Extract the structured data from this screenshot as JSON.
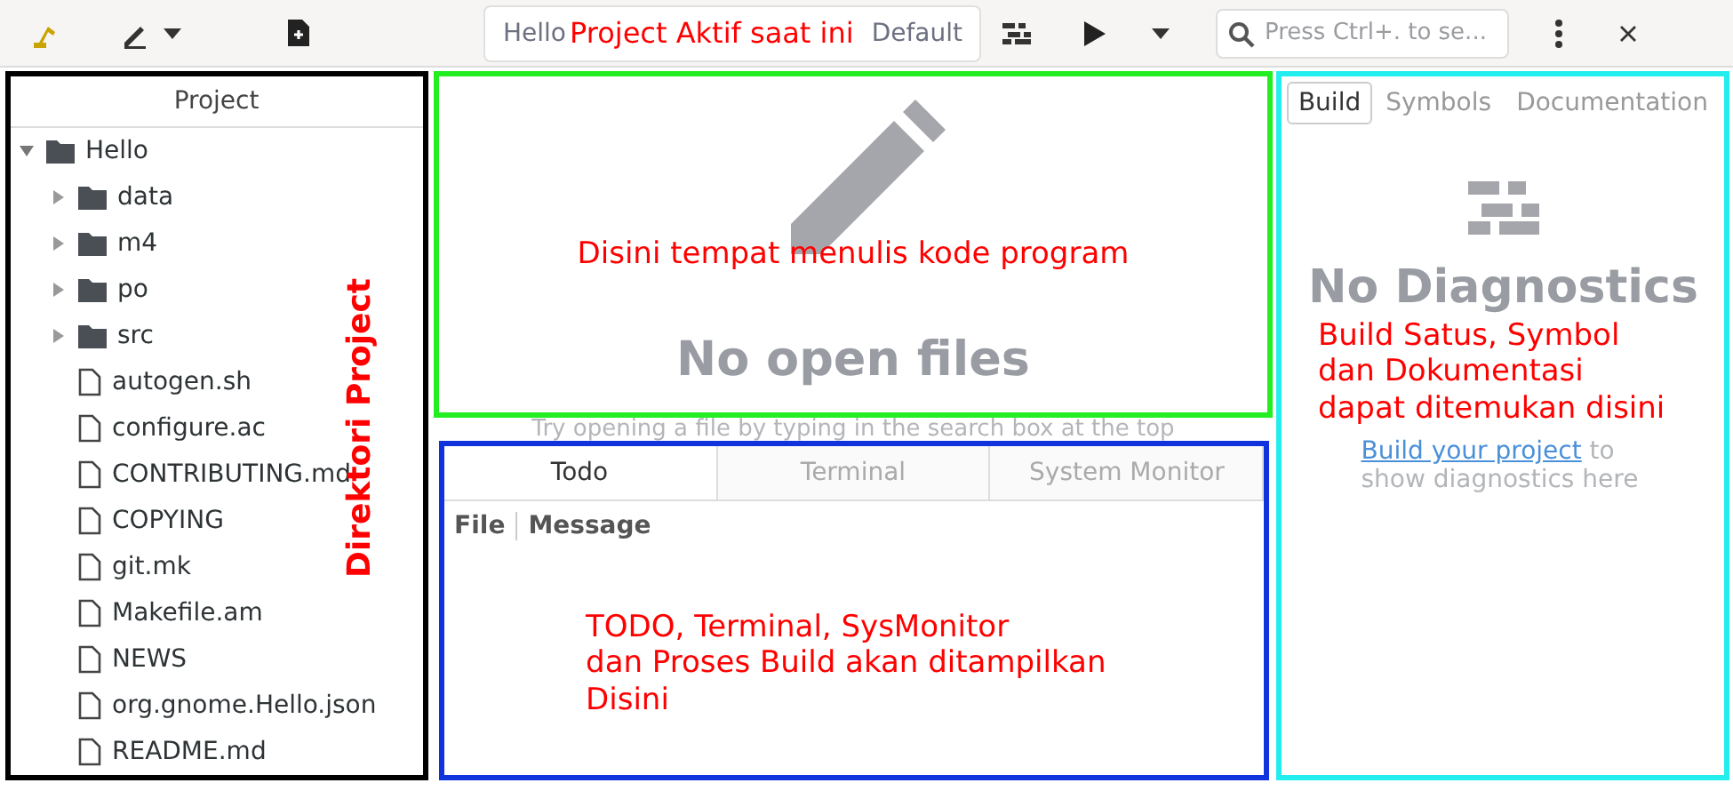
{
  "header": {
    "project_button": "Hello",
    "config_button": "Default",
    "search": {
      "placeholder": "Press Ctrl+. to se..."
    },
    "annotation": "Project Aktif saat ini"
  },
  "sidebar": {
    "title": "Project",
    "annotation": "Direktori Project",
    "tree": [
      {
        "name": "Hello",
        "kind": "folder",
        "expanded": true,
        "children": [
          {
            "name": "data",
            "kind": "folder",
            "expanded": false
          },
          {
            "name": "m4",
            "kind": "folder",
            "expanded": false
          },
          {
            "name": "po",
            "kind": "folder",
            "expanded": false
          },
          {
            "name": "src",
            "kind": "folder",
            "expanded": false
          },
          {
            "name": "autogen.sh",
            "kind": "file"
          },
          {
            "name": "configure.ac",
            "kind": "file"
          },
          {
            "name": "CONTRIBUTING.md",
            "kind": "file"
          },
          {
            "name": "COPYING",
            "kind": "file"
          },
          {
            "name": "git.mk",
            "kind": "file"
          },
          {
            "name": "Makefile.am",
            "kind": "file"
          },
          {
            "name": "NEWS",
            "kind": "file"
          },
          {
            "name": "org.gnome.Hello.json",
            "kind": "file"
          },
          {
            "name": "README.md",
            "kind": "file"
          }
        ]
      }
    ]
  },
  "editor": {
    "annotation": "Disini tempat menulis kode program",
    "title": "No open files",
    "hint": "Try opening a file by typing in the search box at the top"
  },
  "bottom_panel": {
    "tabs": [
      {
        "label": "Todo",
        "selected": true
      },
      {
        "label": "Terminal",
        "selected": false
      },
      {
        "label": "System Monitor",
        "selected": false
      }
    ],
    "columns": [
      "File",
      "Message"
    ],
    "annotation": "TODO, Terminal, SysMonitor\ndan Proses Build akan ditampilkan\nDisini"
  },
  "right_panel": {
    "tabs": [
      {
        "label": "Build",
        "selected": true
      },
      {
        "label": "Symbols",
        "selected": false
      },
      {
        "label": "Documentation",
        "selected": false
      }
    ],
    "title": "No Diagnostics",
    "link": "Build your project",
    "hint": " to show diagnostics here",
    "annotation": "Build Satus, Symbol\ndan Dokumentasi\ndapat ditemukan disini"
  }
}
